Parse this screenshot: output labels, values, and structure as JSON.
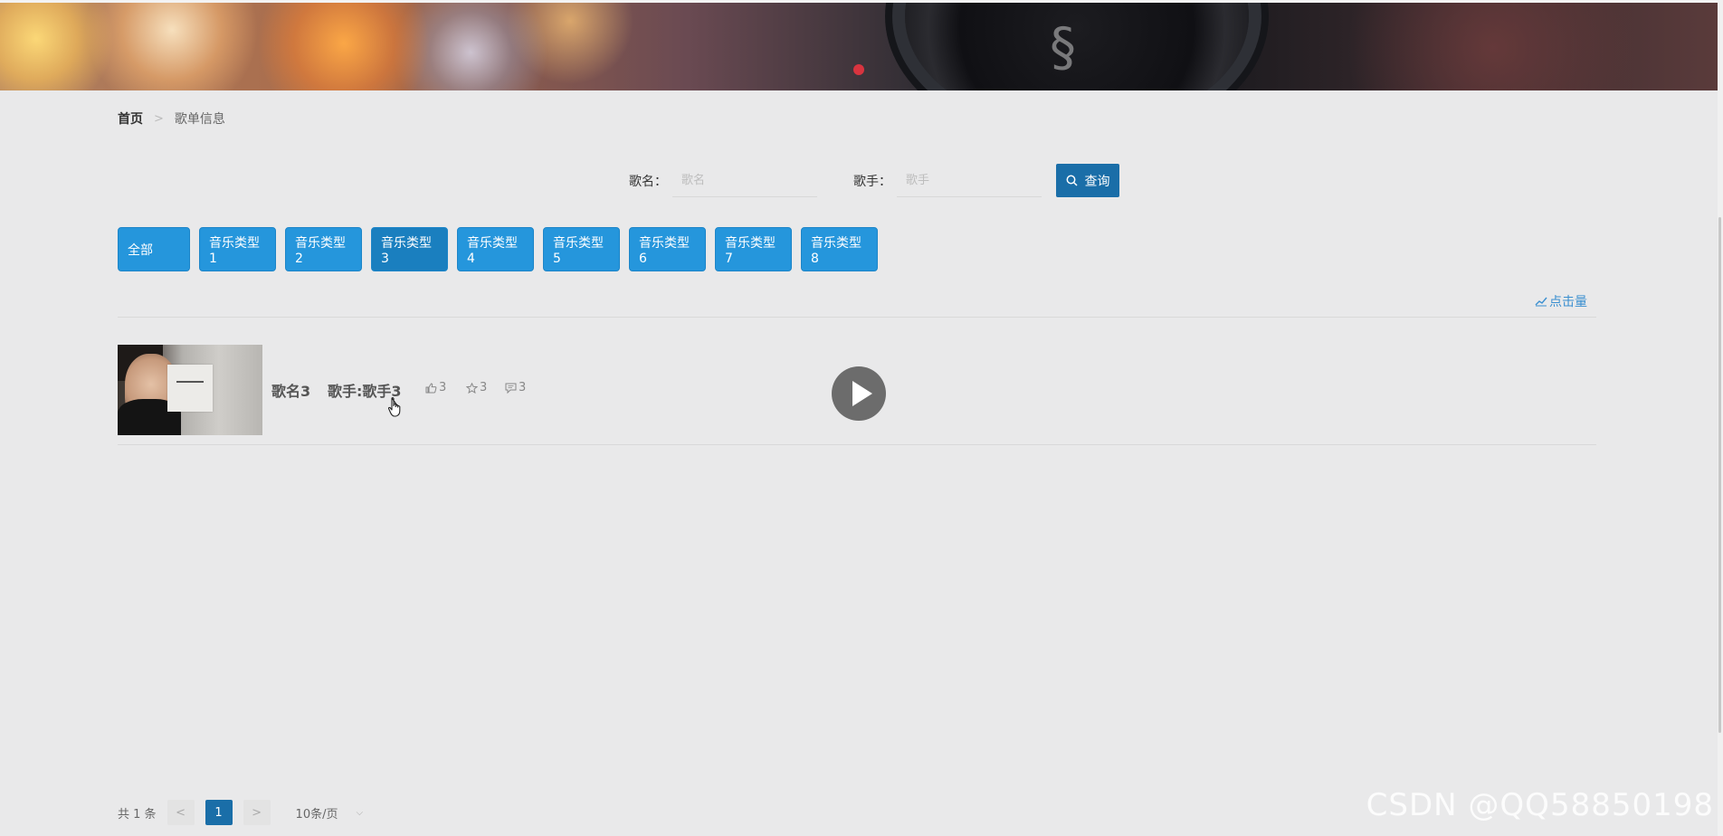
{
  "breadcrumb": {
    "home": "首页",
    "separator": ">",
    "current": "歌单信息"
  },
  "search": {
    "song_label": "歌名：",
    "song_placeholder": "歌名",
    "song_value": "",
    "singer_label": "歌手：",
    "singer_placeholder": "歌手",
    "singer_value": "",
    "query_label": "查询",
    "query_icon": "search-icon"
  },
  "types": {
    "items": [
      "全部",
      "音乐类型1",
      "音乐类型2",
      "音乐类型3",
      "音乐类型4",
      "音乐类型5",
      "音乐类型6",
      "音乐类型7",
      "音乐类型8"
    ],
    "active": "音乐类型3",
    "color": "#2596dc"
  },
  "sort": {
    "label": "点击量",
    "icon": "trend-chart-icon"
  },
  "songs": [
    {
      "title": "歌名3",
      "singer": "歌手:歌手3",
      "likes": "3",
      "favorites": "3",
      "comments": "3"
    }
  ],
  "pagination": {
    "total": "共 1 条",
    "prev": "<",
    "current_page": "1",
    "next": ">",
    "page_size": "10条/页"
  },
  "watermark": "CSDN @QQ58850198",
  "colors": {
    "primary": "#1a6ea8",
    "accent_blue": "#2596dc",
    "link_blue": "#3a8fd0",
    "background": "#e9e9ea"
  }
}
